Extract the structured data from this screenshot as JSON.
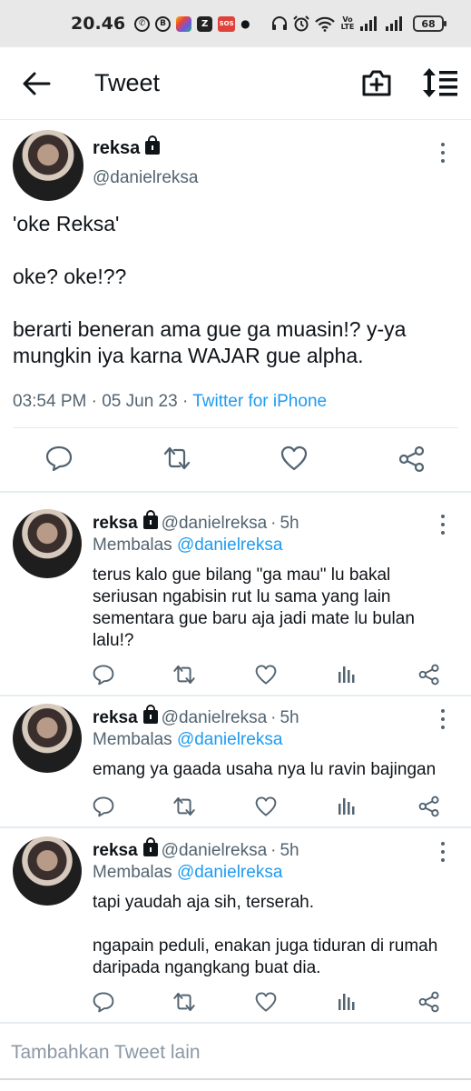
{
  "status_bar": {
    "time": "20.46",
    "battery": "68",
    "volte": "Vo LTE"
  },
  "header": {
    "title": "Tweet"
  },
  "main_tweet": {
    "name": "reksa",
    "handle": "@danielreksa",
    "text": "'oke Reksa'\n\noke? oke!??\n\nberarti beneran ama gue ga muasin!? y-ya mungkin iya karna WAJAR gue alpha.",
    "time": "03:54 PM",
    "date": "05 Jun 23",
    "source": "Twitter for iPhone"
  },
  "replies": [
    {
      "name": "reksa",
      "handle": "@danielreksa",
      "age": "5h",
      "replying_label": "Membalas",
      "replying_to": "@danielreksa",
      "text": "terus kalo gue bilang \"ga mau\" lu bakal seriusan ngabisin rut lu sama yang lain sementara gue baru aja jadi mate lu bulan lalu!?"
    },
    {
      "name": "reksa",
      "handle": "@danielreksa",
      "age": "5h",
      "replying_label": "Membalas",
      "replying_to": "@danielreksa",
      "text": "emang ya gaada usaha nya lu ravin bajingan"
    },
    {
      "name": "reksa",
      "handle": "@danielreksa",
      "age": "5h",
      "replying_label": "Membalas",
      "replying_to": "@danielreksa",
      "text": "tapi yaudah aja sih, terserah.\n\nngapain peduli, enakan juga tiduran di rumah daripada ngangkang buat dia."
    }
  ],
  "compose": {
    "placeholder": "Tambahkan Tweet lain"
  },
  "colors": {
    "link": "#1d9bf0",
    "secondary_text": "#536471",
    "divider": "#e6ecf0"
  }
}
